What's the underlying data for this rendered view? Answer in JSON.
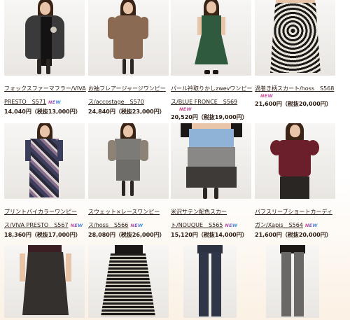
{
  "products": [
    {
      "title": "フォックスファーマフラー/VIVA PRESTO　S571",
      "new": "NEW",
      "price": "14,040円（税抜13,000円）",
      "icon": "coat-photo"
    },
    {
      "title": "お袖フレアージャージワンピース/accostage　S570",
      "new": "",
      "price": "24,840円（税抜23,000円）",
      "icon": "brown-dress-photo"
    },
    {
      "title": "パール衿取りかしzwevワンピース/BLUE FRONCE　S569",
      "new": "NEW",
      "price": "20,520円（税抜19,000円）",
      "icon": "green-dress-photo"
    },
    {
      "title": "渦巻き柄スカート/hoss　S568",
      "new": "NEW",
      "price": "21,600円（税抜20,000円）",
      "icon": "swirl-skirt-photo"
    },
    {
      "title": "プリントバイカラーワンピース/VIVA PRESTO　S567",
      "new": "NEW",
      "price": "18,360円（税抜17,000円）",
      "icon": "print-dress-photo"
    },
    {
      "title": "スウェット×レースワンピース/hoss　S566",
      "new": "NEW",
      "price": "28,080円（税抜26,000円）",
      "icon": "grey-dress-photo"
    },
    {
      "title": "米沢サテン配色スカート/NOUQUE　S565",
      "new": "NEW",
      "price": "15,120円（税抜14,000円）",
      "icon": "colorblock-skirt-photo"
    },
    {
      "title": "パフスリーブショートカーディガン/Xapis　S564",
      "new": "NEW",
      "price": "21,600円（税抜20,000円）",
      "icon": "cardigan-photo"
    }
  ],
  "bottom_photos": [
    "wrap-skirt-photo",
    "striped-skirt-photo",
    "navy-pants-photo",
    "grey-pants-photo"
  ],
  "colors": {
    "text": "#2a1a10",
    "new_gradient": [
      "#e0468a",
      "#6b5bd6",
      "#2aa7d8"
    ],
    "footer_bg": "#fbf1e4"
  }
}
